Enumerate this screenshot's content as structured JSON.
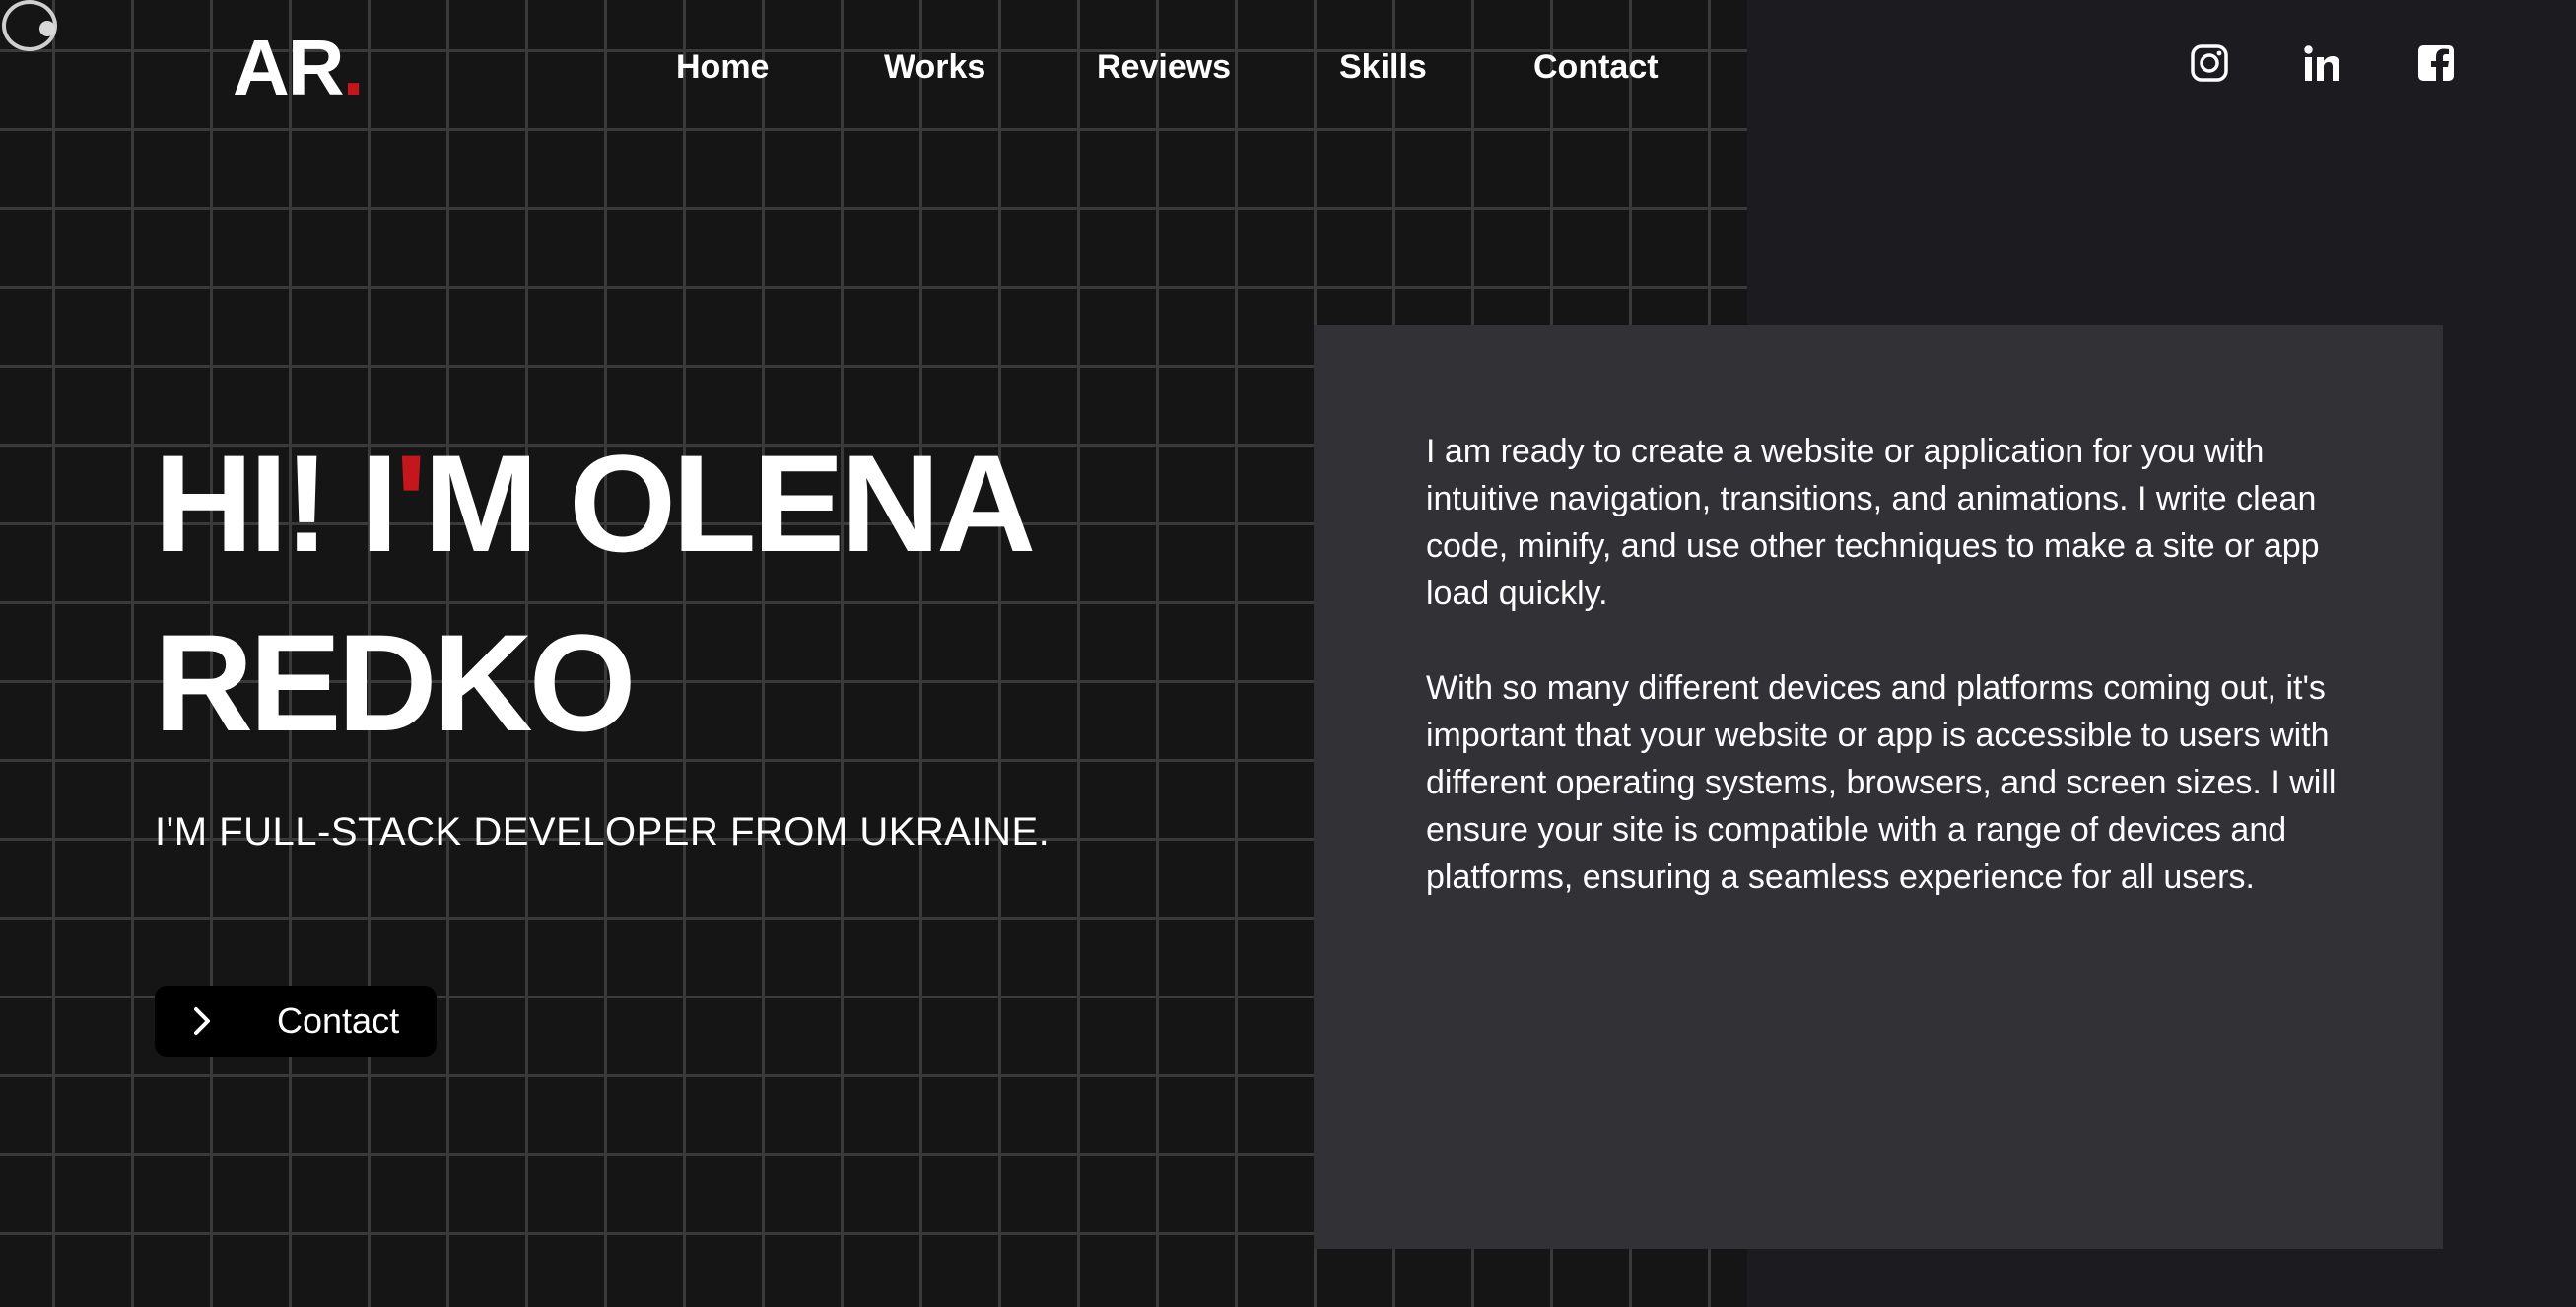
{
  "header": {
    "logo_text": "AR",
    "logo_dot": ".",
    "nav": [
      "Home",
      "Works",
      "Reviews",
      "Skills",
      "Contact"
    ],
    "social": [
      "instagram-icon",
      "linkedin-icon",
      "facebook-icon"
    ]
  },
  "hero": {
    "title_part1": "HI! I",
    "title_apostrophe": "'",
    "title_part2": "M OLENA",
    "title_line2": "REDKO",
    "subtitle": "I'M FULL-STACK DEVELOPER FROM UKRAINE.",
    "contact_button": "Contact"
  },
  "about": {
    "paragraph1": "I am ready to create a website or application for you with intuitive navigation, transitions, and animations. I write clean code, minify, and use other techniques to make a site or app load quickly.",
    "paragraph2": "With so many different devices and platforms coming out, it's important that your website or app is accessible to users with different operating systems, browsers, and screen sizes. I will ensure your site is compatible with a range of devices and platforms, ensuring a seamless experience for all users."
  },
  "colors": {
    "accent": "#c4161c",
    "background_left": "#151515",
    "background_right": "#1c1c20",
    "card": "#313136",
    "button": "#000000",
    "text": "#ffffff"
  }
}
